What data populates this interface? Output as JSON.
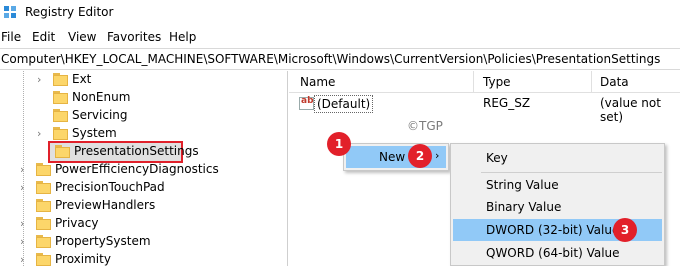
{
  "window": {
    "title": "Registry Editor"
  },
  "menu": [
    "File",
    "Edit",
    "View",
    "Favorites",
    "Help"
  ],
  "address": "Computer\\HKEY_LOCAL_MACHINE\\SOFTWARE\\Microsoft\\Windows\\CurrentVersion\\Policies\\PresentationSettings",
  "tree": {
    "items": [
      {
        "label": "Ext",
        "expandable": true
      },
      {
        "label": "NonEnum",
        "expandable": false
      },
      {
        "label": "Servicing",
        "expandable": false
      },
      {
        "label": "System",
        "expandable": true
      },
      {
        "label": "PresentationSettings",
        "expandable": false,
        "selected": true
      },
      {
        "label": "PowerEfficiencyDiagnostics",
        "expandable": true
      },
      {
        "label": "PrecisionTouchPad",
        "expandable": true
      },
      {
        "label": "PreviewHandlers",
        "expandable": false
      },
      {
        "label": "Privacy",
        "expandable": true
      },
      {
        "label": "PropertySystem",
        "expandable": true
      },
      {
        "label": "Proximity",
        "expandable": true
      }
    ]
  },
  "list": {
    "columns": {
      "name": "Name",
      "type": "Type",
      "data": "Data"
    },
    "rows": [
      {
        "icon": "string-value-icon",
        "name": "(Default)",
        "type": "REG_SZ",
        "data": "(value not set)"
      }
    ]
  },
  "watermark": "©TGP",
  "context_menu": {
    "new_label": "New",
    "submenu": [
      "Key",
      "String Value",
      "Binary Value",
      "DWORD (32-bit) Value",
      "QWORD (64-bit) Value"
    ],
    "highlighted_submenu_item": "DWORD (32-bit) Value"
  },
  "step_badges": [
    "1",
    "2",
    "3"
  ],
  "colors": {
    "selection_highlight": "#91c9f7",
    "badge": "#e2202a",
    "annotation_box": "#e0202a",
    "folder": "#fcd66a"
  }
}
